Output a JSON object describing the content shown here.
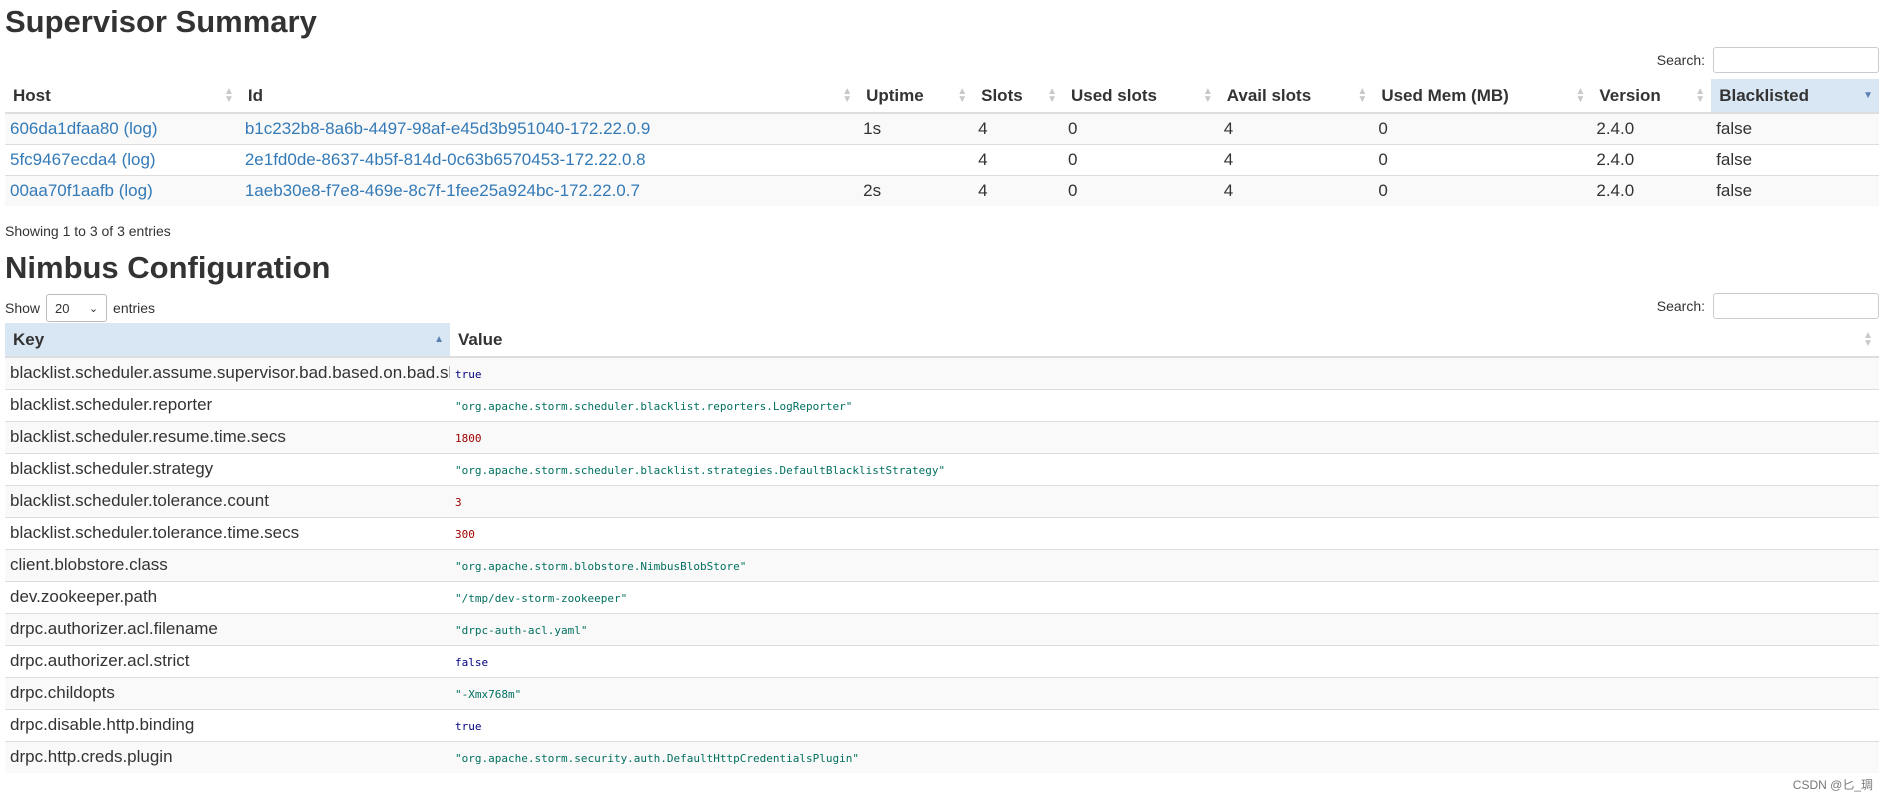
{
  "supervisor_summary": {
    "title": "Supervisor Summary",
    "search_label": "Search:",
    "search_value": "",
    "columns": [
      "Host",
      "Id",
      "Uptime",
      "Slots",
      "Used slots",
      "Avail slots",
      "Used Mem (MB)",
      "Version",
      "Blacklisted"
    ],
    "sorted_column": "Blacklisted",
    "rows": [
      {
        "host": "606da1dfaa80",
        "log": "(log)",
        "id": "b1c232b8-8a6b-4497-98af-e45d3b951040-172.22.0.9",
        "uptime": "1s",
        "slots": "4",
        "used_slots": "0",
        "avail_slots": "4",
        "used_mem": "0",
        "version": "2.4.0",
        "blacklisted": "false"
      },
      {
        "host": "5fc9467ecda4",
        "log": "(log)",
        "id": "2e1fd0de-8637-4b5f-814d-0c63b6570453-172.22.0.8",
        "uptime": "",
        "slots": "4",
        "used_slots": "0",
        "avail_slots": "4",
        "used_mem": "0",
        "version": "2.4.0",
        "blacklisted": "false"
      },
      {
        "host": "00aa70f1aafb",
        "log": "(log)",
        "id": "1aeb30e8-f7e8-469e-8c7f-1fee25a924bc-172.22.0.7",
        "uptime": "2s",
        "slots": "4",
        "used_slots": "0",
        "avail_slots": "4",
        "used_mem": "0",
        "version": "2.4.0",
        "blacklisted": "false"
      }
    ],
    "info": "Showing 1 to 3 of 3 entries"
  },
  "nimbus_configuration": {
    "title": "Nimbus Configuration",
    "show_label": "Show",
    "page_size": "20",
    "entries_label": "entries",
    "search_label": "Search:",
    "search_value": "",
    "columns": [
      "Key",
      "Value"
    ],
    "sorted_column": "Key",
    "rows": [
      {
        "key": "blacklist.scheduler.assume.supervisor.bad.based.on.bad.slot",
        "value": "true",
        "type": "boolean"
      },
      {
        "key": "blacklist.scheduler.reporter",
        "value": "\"org.apache.storm.scheduler.blacklist.reporters.LogReporter\"",
        "type": "string"
      },
      {
        "key": "blacklist.scheduler.resume.time.secs",
        "value": "1800",
        "type": "number"
      },
      {
        "key": "blacklist.scheduler.strategy",
        "value": "\"org.apache.storm.scheduler.blacklist.strategies.DefaultBlacklistStrategy\"",
        "type": "string"
      },
      {
        "key": "blacklist.scheduler.tolerance.count",
        "value": "3",
        "type": "number"
      },
      {
        "key": "blacklist.scheduler.tolerance.time.secs",
        "value": "300",
        "type": "number"
      },
      {
        "key": "client.blobstore.class",
        "value": "\"org.apache.storm.blobstore.NimbusBlobStore\"",
        "type": "string"
      },
      {
        "key": "dev.zookeeper.path",
        "value": "\"/tmp/dev-storm-zookeeper\"",
        "type": "string"
      },
      {
        "key": "drpc.authorizer.acl.filename",
        "value": "\"drpc-auth-acl.yaml\"",
        "type": "string"
      },
      {
        "key": "drpc.authorizer.acl.strict",
        "value": "false",
        "type": "boolean"
      },
      {
        "key": "drpc.childopts",
        "value": "\"-Xmx768m\"",
        "type": "string"
      },
      {
        "key": "drpc.disable.http.binding",
        "value": "true",
        "type": "boolean"
      },
      {
        "key": "drpc.http.creds.plugin",
        "value": "\"org.apache.storm.security.auth.DefaultHttpCredentialsPlugin\"",
        "type": "string"
      }
    ]
  },
  "watermark": "CSDN @匕_琱",
  "colors": {
    "link": "#337ab7",
    "sorted_header": "#d9e6f3",
    "boolean": "#000080",
    "number": "#a00000",
    "string": "#007060"
  }
}
